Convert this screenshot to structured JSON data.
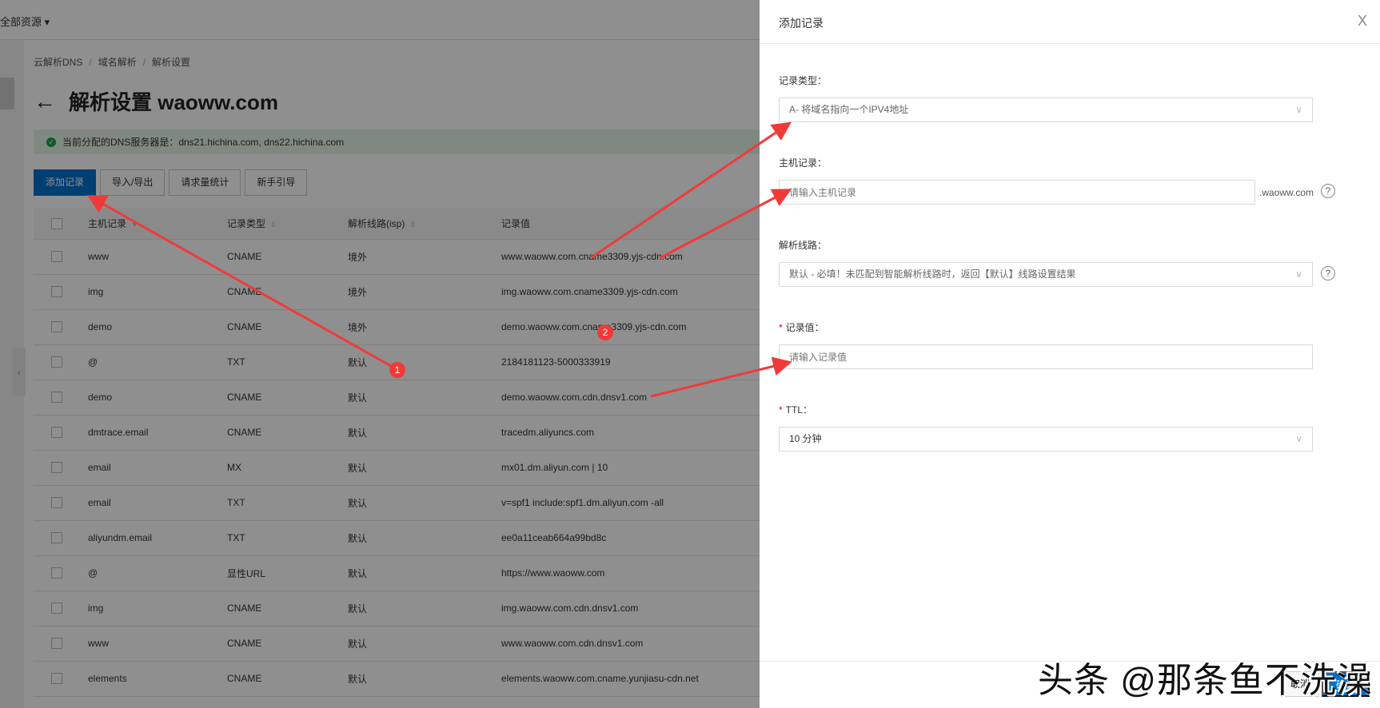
{
  "topbar": {
    "resource_label": "全部资源 ▾"
  },
  "breadcrumb": [
    "云解析DNS",
    "域名解析",
    "解析设置"
  ],
  "page_title": "解析设置 waoww.com",
  "alert": "当前分配的DNS服务器是：dns21.hichina.com, dns22.hichina.com",
  "toolbar": {
    "add": "添加记录",
    "import_export": "导入/导出",
    "stats": "请求量统计",
    "guide": "新手引导"
  },
  "table": {
    "headers": [
      "主机记录",
      "记录类型",
      "解析线路(isp)",
      "记录值"
    ],
    "rows": [
      [
        "www",
        "CNAME",
        "境外",
        "www.waoww.com.cname3309.yjs-cdn.com"
      ],
      [
        "img",
        "CNAME",
        "境外",
        "img.waoww.com.cname3309.yjs-cdn.com"
      ],
      [
        "demo",
        "CNAME",
        "境外",
        "demo.waoww.com.cname3309.yjs-cdn.com"
      ],
      [
        "@",
        "TXT",
        "默认",
        "2184181123-5000333919"
      ],
      [
        "demo",
        "CNAME",
        "默认",
        "demo.waoww.com.cdn.dnsv1.com"
      ],
      [
        "dmtrace.email",
        "CNAME",
        "默认",
        "tracedm.aliyuncs.com"
      ],
      [
        "email",
        "MX",
        "默认",
        "mx01.dm.aliyun.com | 10"
      ],
      [
        "email",
        "TXT",
        "默认",
        "v=spf1 include:spf1.dm.aliyun.com -all"
      ],
      [
        "aliyundm.email",
        "TXT",
        "默认",
        "ee0a11ceab664a99bd8c"
      ],
      [
        "@",
        "显性URL",
        "默认",
        "https://www.waoww.com"
      ],
      [
        "img",
        "CNAME",
        "默认",
        "img.waoww.com.cdn.dnsv1.com"
      ],
      [
        "www",
        "CNAME",
        "默认",
        "www.waoww.com.cdn.dnsv1.com"
      ],
      [
        "elements",
        "CNAME",
        "默认",
        "elements.waoww.com.cname.yunjiasu-cdn.net"
      ]
    ]
  },
  "panel": {
    "title": "添加记录",
    "close": "X",
    "record_type": {
      "label": "记录类型：",
      "value": "A- 将域名指向一个IPV4地址"
    },
    "host": {
      "label": "主机记录：",
      "placeholder": "请输入主机记录",
      "suffix": ".waoww.com"
    },
    "line": {
      "label": "解析线路：",
      "value": "默认 - 必填！未匹配到智能解析线路时，返回【默认】线路设置结果"
    },
    "value": {
      "label": "记录值：",
      "placeholder": "请输入记录值"
    },
    "ttl": {
      "label": "TTL：",
      "value": "10 分钟"
    },
    "required_mark": "*",
    "help": "?",
    "cancel": "取消",
    "confirm": "确认"
  },
  "annotations": {
    "badge1": "1",
    "badge2": "2",
    "watermark": "头条 @那条鱼不洗澡"
  }
}
